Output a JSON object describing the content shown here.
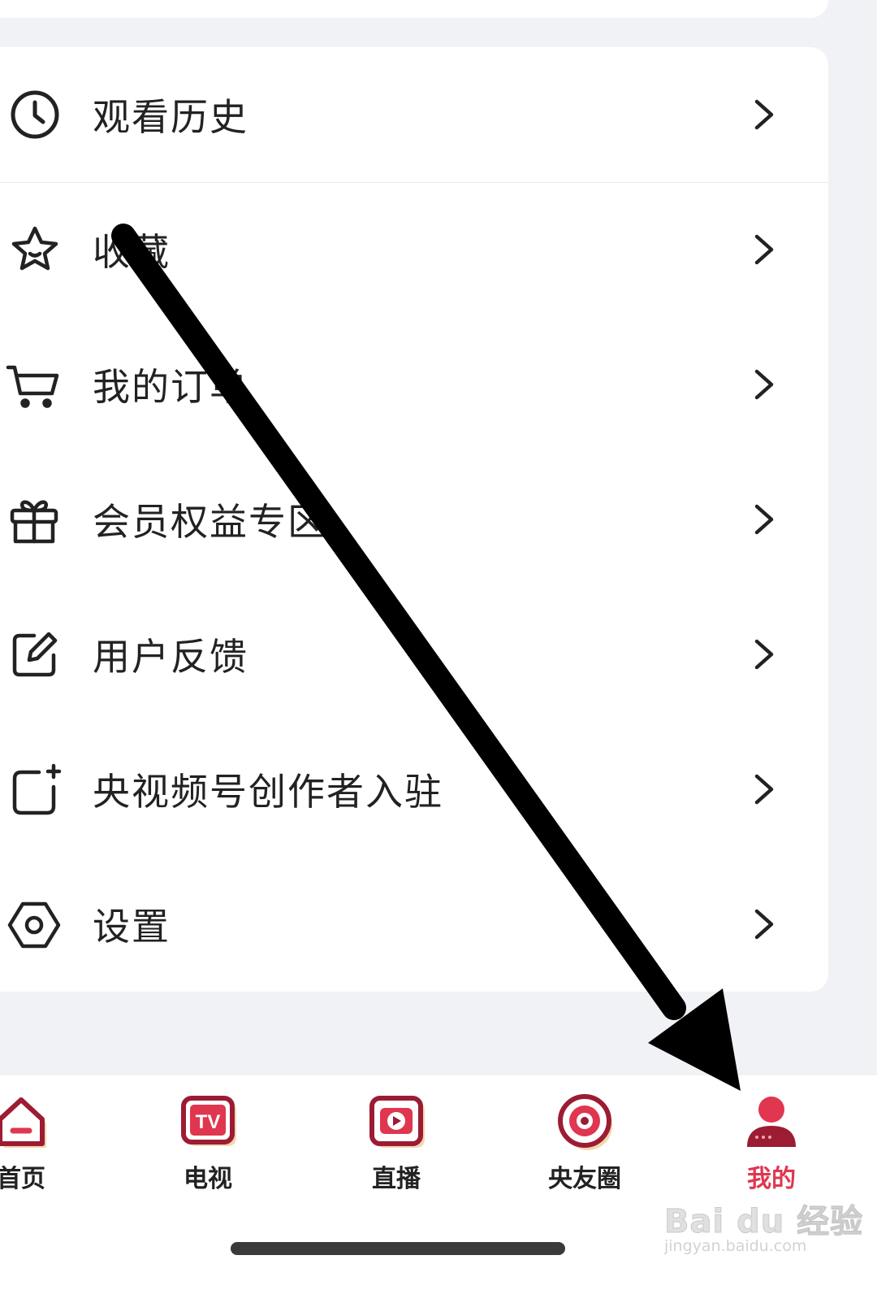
{
  "menu": {
    "items": [
      {
        "label": "观看历史",
        "icon": "clock-icon"
      },
      {
        "label": "收藏",
        "icon": "star-icon"
      },
      {
        "label": "我的订单",
        "icon": "cart-icon"
      },
      {
        "label": "会员权益专区",
        "icon": "gift-icon"
      },
      {
        "label": "用户反馈",
        "icon": "edit-icon"
      },
      {
        "label": "央视频号创作者入驻",
        "icon": "add-square-icon"
      },
      {
        "label": "设置",
        "icon": "hexagon-settings-icon"
      }
    ]
  },
  "tabbar": {
    "tabs": [
      {
        "label": "首页",
        "icon": "home-icon"
      },
      {
        "label": "电视",
        "icon": "tv-icon"
      },
      {
        "label": "直播",
        "icon": "live-play-icon"
      },
      {
        "label": "央友圈",
        "icon": "target-icon"
      },
      {
        "label": "我的",
        "icon": "person-icon",
        "active": true
      }
    ]
  },
  "watermark": {
    "main": "Bai du 经验",
    "sub": "jingyan.baidu.com"
  },
  "colors": {
    "accent": "#e0364f",
    "icon_maroon": "#9c1c33",
    "icon_shadow": "#f3d7b0",
    "background": "#f1f2f5"
  }
}
